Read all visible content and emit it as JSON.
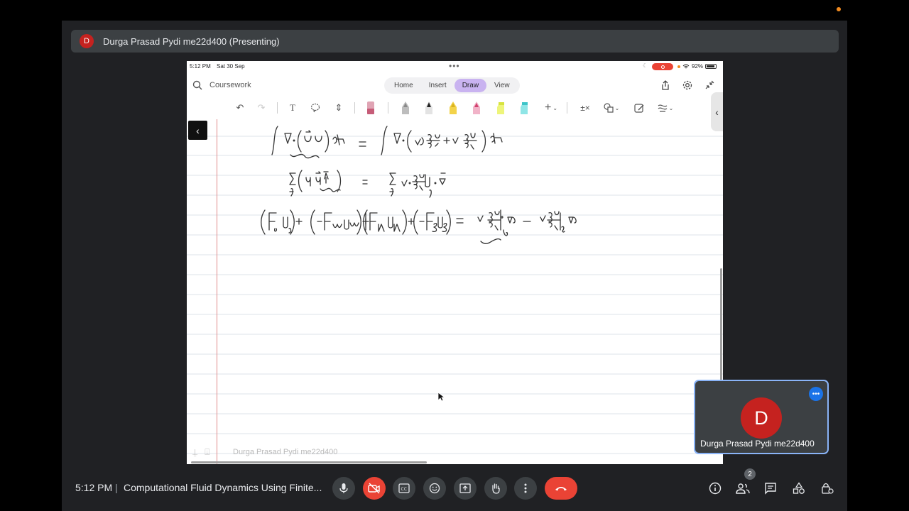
{
  "colors": {
    "avatar_red": "#c5221f",
    "draw_tab_purple": "#c9b3f0",
    "end_call_red": "#ea4335",
    "margin_red": "#e08a8a",
    "rule_blue": "#dde3ea",
    "orange_dot": "#f28b20",
    "selfview_border": "#8ab4f8",
    "more_blue": "#1a73e8"
  },
  "presenter_bar": {
    "avatar_letter": "D",
    "text": "Durga Prasad Pydi me22d400 (Presenting)"
  },
  "ipad": {
    "status": {
      "time": "5:12 PM",
      "date": "Sat 30 Sep",
      "dots": "•••",
      "battery": "92%"
    },
    "search_placeholder": "Coursework",
    "tabs": [
      {
        "label": "Home"
      },
      {
        "label": "Insert"
      },
      {
        "label": "Draw",
        "active": true
      },
      {
        "label": "View"
      }
    ],
    "toolbar_icons": [
      "undo-icon",
      "redo-icon",
      "text-tool-icon",
      "lasso-icon",
      "insert-space-icon",
      "eraser-icon",
      "pencil-icon",
      "pen-black-icon",
      "highlighter-yellow-icon",
      "pen-pink-icon",
      "highlighter-lime-icon",
      "highlighter-cyan-icon",
      "add-pen-icon",
      "math-icon",
      "shapes-icon",
      "ink-to-text-icon",
      "ruler-icon"
    ],
    "page": {
      "watermark_name": "Durga Prasad Pydi me22d400",
      "handwriting_lines": [
        "∫ ∇ · ( u⃗ u ) dV = ∫ ∇ · ( ν ∂u/∂x + ν ∂u/∂y ) dV",
        "Σ_f ( u_f u⃗_f · A⃗_f ) = Σ_f ν · ∂u/∂y |_f ĵ · A⃗_f",
        "(F_e u_e) + (−F_w u_w) + (F_n u_n) + (−F_s u_s) = ν ∂u/∂y |_n Δx − ν ∂u/∂y |_s Δx"
      ]
    }
  },
  "selfview": {
    "avatar_letter": "D",
    "name": "Durga Prasad Pydi me22d400",
    "more": "•••"
  },
  "bottom_bar": {
    "time": "5:12 PM",
    "separator": "|",
    "meeting_title": "Computational Fluid Dynamics Using Finite...",
    "people_count": "2"
  }
}
